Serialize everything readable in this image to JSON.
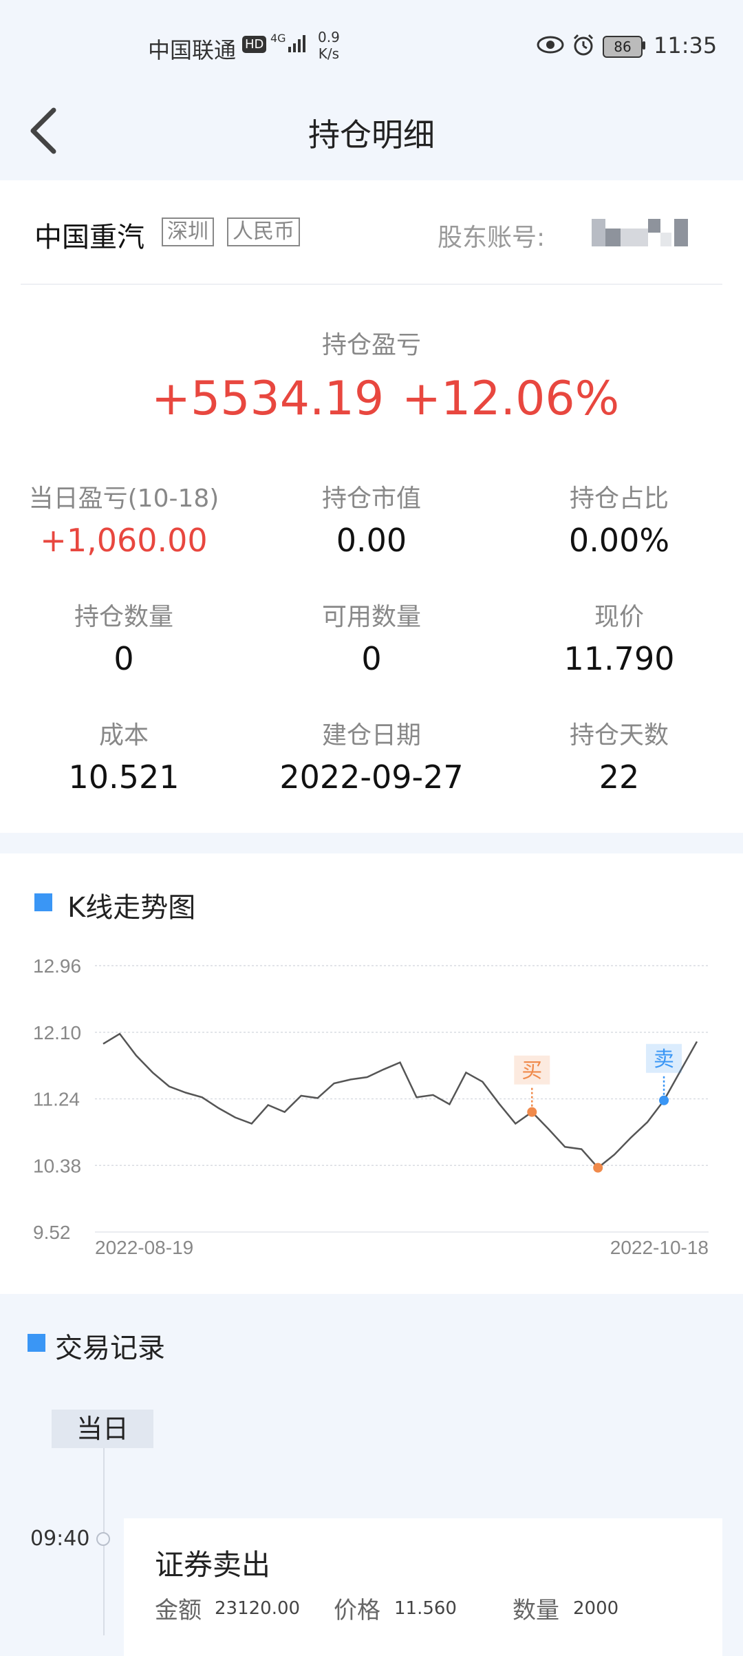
{
  "status_bar": {
    "carrier": "中国联通",
    "hd_badge": "HD",
    "network": "4G",
    "speed_value": "0.9",
    "speed_unit": "K/s",
    "battery": "86",
    "time": "11:35"
  },
  "header": {
    "title": "持仓明细"
  },
  "stock": {
    "name": "中国重汽",
    "market_tag": "深圳",
    "currency_tag": "人民币",
    "account_label": "股东账号:"
  },
  "pnl": {
    "label": "持仓盈亏",
    "amount": "+5534.19",
    "percent": "+12.06%"
  },
  "stats": [
    {
      "label": "当日盈亏(10-18)",
      "value": "+1,060.00",
      "red": true
    },
    {
      "label": "持仓市值",
      "value": "0.00"
    },
    {
      "label": "持仓占比",
      "value": "0.00%"
    },
    {
      "label": "持仓数量",
      "value": "0"
    },
    {
      "label": "可用数量",
      "value": "0"
    },
    {
      "label": "现价",
      "value": "11.790"
    },
    {
      "label": "成本",
      "value": "10.521"
    },
    {
      "label": "建仓日期",
      "value": "2022-09-27"
    },
    {
      "label": "持仓天数",
      "value": "22"
    }
  ],
  "kline_section": {
    "title": "K线走势图"
  },
  "chart_data": {
    "type": "line",
    "y_ticks": [
      "12.96",
      "12.10",
      "11.24",
      "10.38",
      "9.52"
    ],
    "ylim": [
      9.52,
      12.96
    ],
    "x_start_label": "2022-08-19",
    "x_end_label": "2022-10-18",
    "series": [
      {
        "values": [
          11.95,
          12.08,
          11.8,
          11.58,
          11.4,
          11.32,
          11.26,
          11.12,
          11.0,
          10.92,
          11.16,
          11.07,
          11.28,
          11.25,
          11.44,
          11.49,
          11.52,
          11.62,
          11.71,
          11.26,
          11.29,
          11.17,
          11.58,
          11.46,
          11.18,
          10.92,
          11.07,
          10.85,
          10.62,
          10.59,
          10.35,
          10.52,
          10.74,
          10.94,
          11.22,
          11.6,
          11.98
        ]
      }
    ],
    "markers": [
      {
        "label": "买",
        "index": 26,
        "value": 11.07,
        "color": "#f08a4b"
      },
      {
        "label": "卖",
        "index": 34,
        "value": 11.22,
        "color": "#3a96f5"
      }
    ],
    "low_point": {
      "index": 30,
      "value": 10.35,
      "color": "#f08a4b"
    }
  },
  "trade_section": {
    "title": "交易记录",
    "day_tag": "当日",
    "records": [
      {
        "time": "09:40",
        "type": "证券卖出",
        "amount_label": "金额",
        "amount": "23120.00",
        "price_label": "价格",
        "price": "11.560",
        "qty_label": "数量",
        "qty": "2000"
      }
    ]
  },
  "colors": {
    "accent": "#3a96f5",
    "gain": "#e8473f",
    "buy": "#f08a4b"
  }
}
